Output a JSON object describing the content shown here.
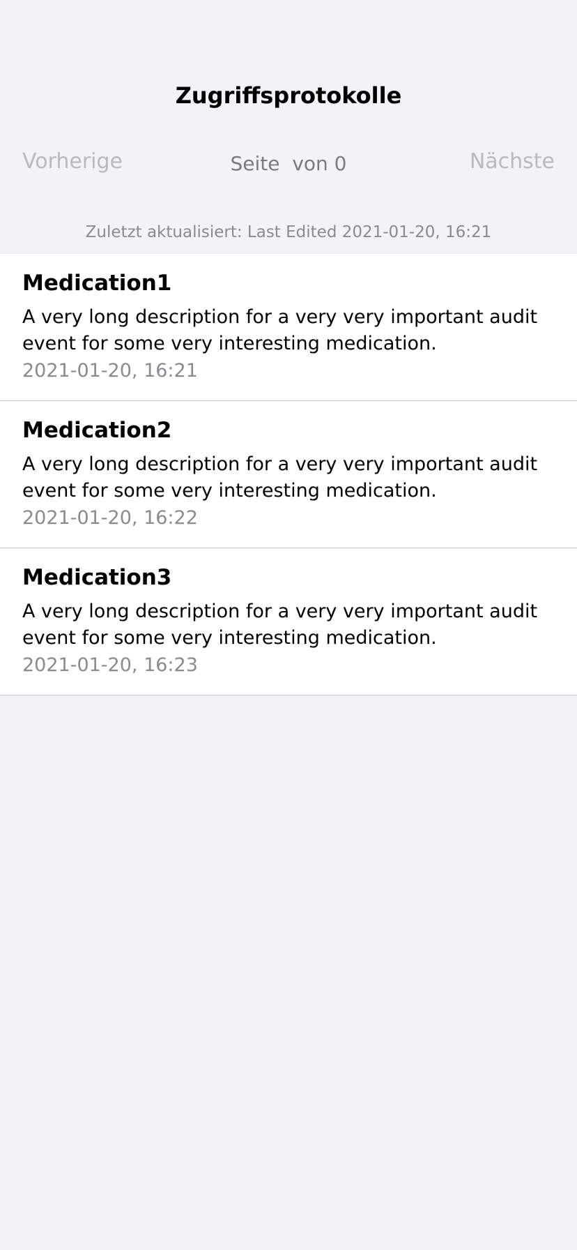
{
  "header": {
    "title": "Zugriffsprotokolle"
  },
  "pager": {
    "prev_label": "Vorherige",
    "next_label": "Nächste",
    "page_label": "Seite",
    "page_current": "",
    "page_of_label": "von 0"
  },
  "status": {
    "last_updated": "Zuletzt aktualisiert: Last Edited 2021-01-20, 16:21"
  },
  "items": [
    {
      "title": "Medication1",
      "description": "A very long description for a very very important audit event for some very interesting medication.",
      "timestamp": "2021-01-20, 16:21"
    },
    {
      "title": "Medication2",
      "description": "A very long description for a very very important audit event for some very interesting medication.",
      "timestamp": "2021-01-20, 16:22"
    },
    {
      "title": "Medication3",
      "description": "A very long description for a very very important audit event for some very interesting medication.",
      "timestamp": "2021-01-20, 16:23"
    }
  ],
  "colors": {
    "background": "#f2f2f7",
    "disabled_text": "#b9b9be",
    "secondary_text": "#8a8a8f",
    "separator": "#c8c8cc"
  }
}
